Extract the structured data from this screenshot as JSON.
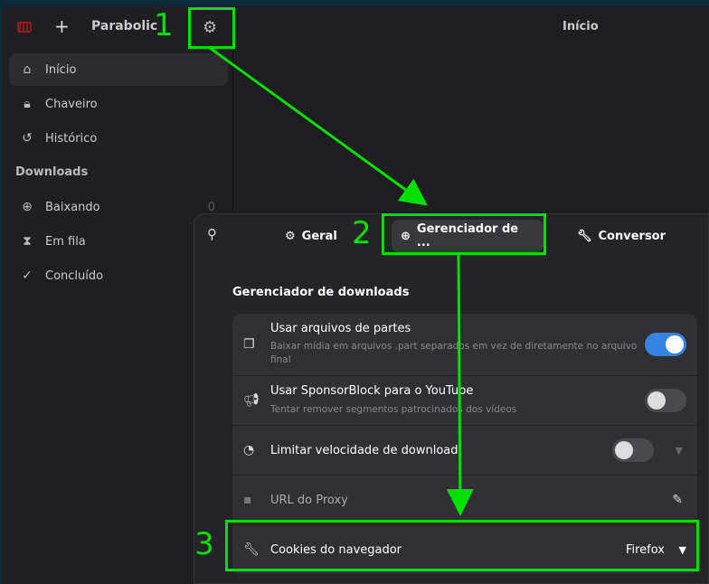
{
  "app": {
    "title": "Parabolic",
    "main_title": "Início"
  },
  "sidebar": {
    "items": [
      {
        "label": "Início",
        "icon": "home-icon"
      },
      {
        "label": "Chaveiro",
        "icon": "keyhole-icon"
      },
      {
        "label": "Histórico",
        "icon": "history-icon"
      }
    ],
    "section": "Downloads",
    "downloads": [
      {
        "label": "Baixando",
        "count": "0"
      },
      {
        "label": "Em fila"
      },
      {
        "label": "Concluído"
      }
    ]
  },
  "dialog": {
    "tabs": [
      "Geral",
      "Gerenciador de ...",
      "Conversor"
    ],
    "heading": "Gerenciador de downloads",
    "rows": [
      {
        "title": "Usar arquivos de partes",
        "subtitle": "Baixar mídia em arquivos .part separados em vez de diretamente no arquivo final",
        "toggle": true
      },
      {
        "title": "Usar SponsorBlock para o YouTube",
        "subtitle": "Tentar remover segmentos patrocinados dos vídeos",
        "toggle": false
      },
      {
        "title": "Limitar velocidade de download",
        "toggle": false
      },
      {
        "title": "URL do Proxy"
      },
      {
        "title": "Cookies do navegador",
        "value": "Firefox"
      }
    ]
  },
  "annotations": [
    "1",
    "2",
    "3"
  ],
  "colors": {
    "accent": "#3584e4",
    "annotation": "#00e000"
  }
}
